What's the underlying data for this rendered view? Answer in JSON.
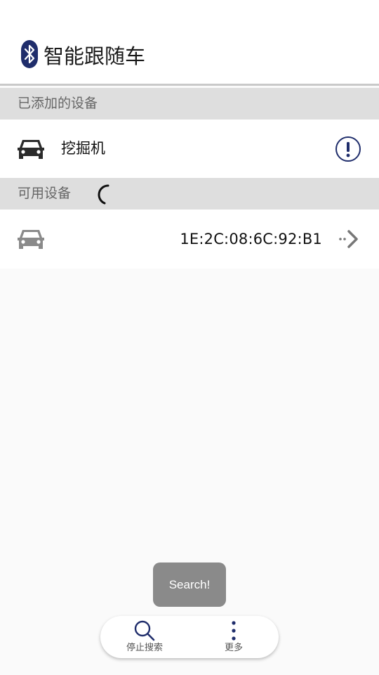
{
  "app": {
    "title": "智能跟随车",
    "icon": "bluetooth-icon"
  },
  "colors": {
    "brand": "#1f2d6b",
    "section_bg": "#dedede",
    "toast_bg": "#8a8a8a"
  },
  "added_devices": {
    "header": "已添加的设备",
    "items": [
      {
        "name": "挖掘机",
        "icon": "car-icon",
        "action_icon": "info-icon"
      }
    ]
  },
  "available_devices": {
    "header": "可用设备",
    "scanning_icon": "loading-spinner-icon",
    "items": [
      {
        "mac": "1E:2C:08:6C:92:B1",
        "icon": "car-icon",
        "action_icon": "connect-arrow-icon"
      }
    ]
  },
  "toast": {
    "text": "Search!"
  },
  "bottom_nav": {
    "items": [
      {
        "label": "停止搜索",
        "icon": "search-icon"
      },
      {
        "label": "更多",
        "icon": "more-vertical-icon"
      }
    ]
  }
}
